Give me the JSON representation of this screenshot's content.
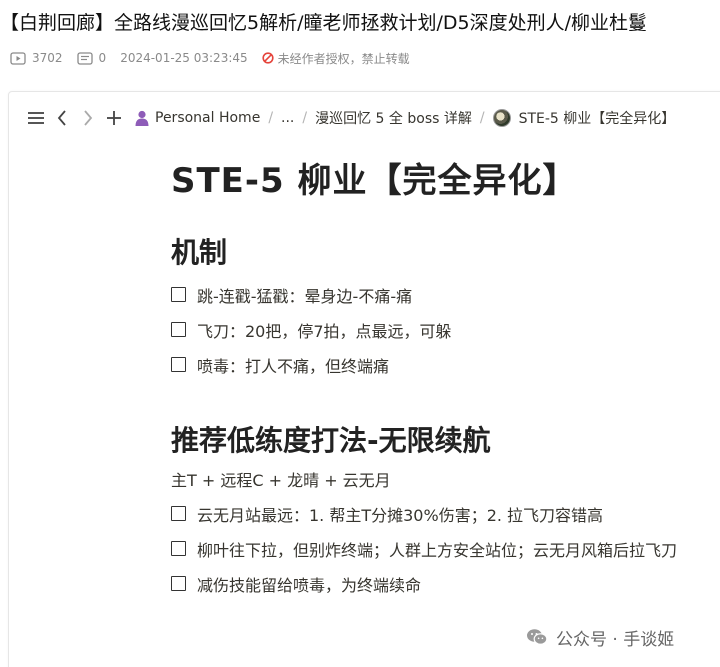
{
  "article": {
    "title": "【白荆回廊】全路线漫巡回忆5解析/瞳老师拯救计划/D5深度处刑人/柳业杜鬘",
    "views": "3702",
    "comments": "0",
    "timestamp": "2024-01-25 03:23:45",
    "notice": "未经作者授权，禁止转载",
    "notice_color": "#e5443b"
  },
  "toolbar": {
    "icons": [
      "menu-icon",
      "back-icon",
      "forward-icon",
      "add-icon"
    ],
    "breadcrumb_home": "Personal Home",
    "breadcrumb_ellipsis": "...",
    "breadcrumb_parent": "漫巡回忆 5 全 boss 详解",
    "breadcrumb_current": "STE-5 柳业【完全异化】",
    "separator": "/"
  },
  "doc": {
    "title": "STE-5 柳业【完全异化】",
    "section1": {
      "heading": "机制",
      "items": [
        "跳-连戳-猛戳：晕身边-不痛-痛",
        "飞刀：20把，停7拍，点最远，可躲",
        "喷毒：打人不痛，但终端痛"
      ]
    },
    "section2": {
      "heading": "推荐低练度打法-无限续航",
      "team": "主T + 远程C + 龙晴 + 云无月",
      "items": [
        "云无月站最远：1. 帮主T分摊30%伤害；2. 拉飞刀容错高",
        "柳叶往下拉，但别炸终端；人群上方安全站位；云无月风箱后拉飞刀",
        "减伤技能留给喷毒，为终端续命"
      ]
    }
  },
  "watermark": {
    "text": "公众号 · 手谈姬",
    "icon": "wechat-icon"
  }
}
